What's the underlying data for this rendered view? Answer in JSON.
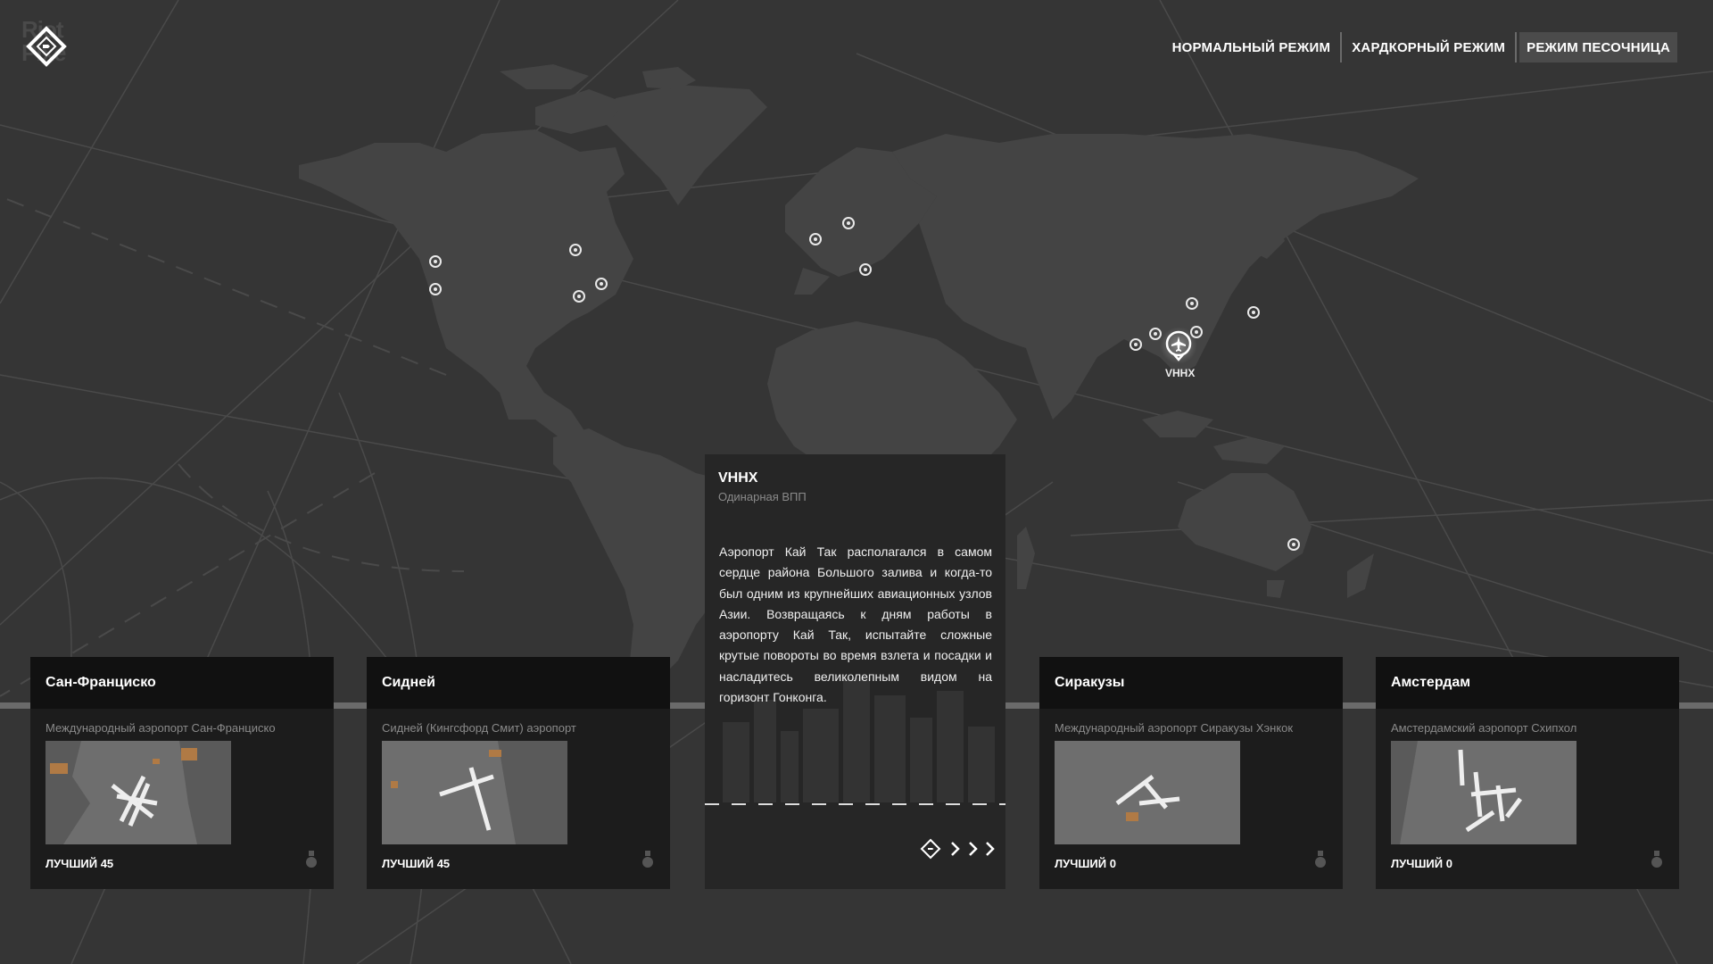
{
  "modes": [
    {
      "label": "НОРМАЛЬНЫЙ РЕЖИМ",
      "active": true
    },
    {
      "label": "ХАРДКОРНЫЙ РЕЖИМ",
      "active": false
    },
    {
      "label": "РЕЖИМ ПЕСОЧНИЦА",
      "active": false
    }
  ],
  "logo_text": "Riot Pixels",
  "map": {
    "selected_code": "VHHX"
  },
  "airports": [
    {
      "title": "Сан-Франциско",
      "subtitle": "Международный аэропорт Сан-Франциско",
      "best": "ЛУЧШИЙ 45"
    },
    {
      "title": "Сидней",
      "subtitle": "Сидней (Кингсфорд Смит) аэропорт",
      "best": "ЛУЧШИЙ 45"
    },
    {
      "title": "Сиракузы",
      "subtitle": "Международный аэропорт Сиракузы Хэнкок",
      "best": "ЛУЧШИЙ 0"
    },
    {
      "title": "Амстердам",
      "subtitle": "Амстердамский аэропорт Схипхол",
      "best": "ЛУЧШИЙ 0"
    }
  ],
  "detail": {
    "code": "VHHX",
    "type": "Одинарная ВПП",
    "description": "Аэропорт Кай Так располагался в самом сердце района Большого залива и когда-то был одним из крупнейших авиационных узлов Азии. Возвращаясь к дням работы в аэропорту Кай Так, испытайте сложные крутые повороты во время взлета и посадки и насладитесь великолепным видом на горизонт Гонконга."
  },
  "colors": {
    "background": "#353535",
    "continent": "#444444",
    "card_header": "#111111",
    "card_body": "#1c1c1c",
    "accent_orange": "#b07a45"
  }
}
